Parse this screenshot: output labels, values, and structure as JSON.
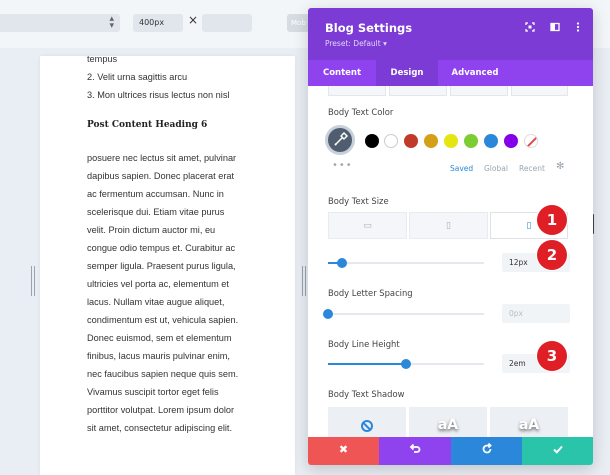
{
  "toolbar": {
    "width_value": "400px",
    "times_symbol": "×",
    "mobile_label": "Mob"
  },
  "preview": {
    "list_items": [
      "tempus",
      "2. Velit urna sagittis arcu",
      "3. Mon ultrices risus lectus non nisl"
    ],
    "heading": "Post Content Heading 6",
    "paragraph_lines": [
      "posuere nec lectus sit amet, pulvinar",
      "dapibus sapien. Donec placerat erat",
      "ac fermentum accumsan. Nunc in",
      "scelerisque dui. Etiam vitae purus",
      "velit. Proin dictum auctor mi, eu",
      "congue odio tempus et. Curabitur ac",
      "semper ligula. Praesent purus ligula,",
      "ultricies vel porta ac, elementum et",
      "lacus. Nullam vitae augue aliquet,",
      "condimentum est ut, vehicula sapien.",
      "Donec euismod, sem et elementum",
      "finibus, lacus mauris pulvinar enim,",
      "nec faucibus sapien neque quis sem.",
      "Vivamus suscipit tortor eget felis",
      "porttitor volutpat. Lorem ipsum dolor",
      "sit amet, consectetur adipiscing elit."
    ]
  },
  "panel": {
    "title": "Blog Settings",
    "preset": "Preset: Default ▾",
    "tabs": [
      "Content",
      "Design",
      "Advanced"
    ],
    "active_tab": "Design",
    "body_text_color_label": "Body Text Color",
    "swatches": [
      "#000000",
      "#ffffff",
      "#c0392b",
      "#d4a017",
      "#e5e510",
      "#7ccd34",
      "#2b87da",
      "#8300e9"
    ],
    "color_source_tabs": [
      "Saved",
      "Global",
      "Recent"
    ],
    "more_dots": "•••",
    "body_text_size_label": "Body Text Size",
    "text_size_value": "12px",
    "text_size_fraction": 0.09,
    "letter_spacing_label": "Body Letter Spacing",
    "letter_spacing_placeholder": "0px",
    "letter_spacing_fraction": 0.0,
    "line_height_label": "Body Line Height",
    "line_height_value": "2em",
    "line_height_fraction": 0.5,
    "text_shadow_label": "Body Text Shadow",
    "shadow_preview_text": "aA",
    "footer_colors": {
      "cancel": "#ef5555",
      "undo": "#8f43ee",
      "redo": "#2b87da",
      "save": "#29c4a9"
    },
    "accent": "#7b3bd4"
  },
  "annotations": [
    "1",
    "2",
    "3"
  ]
}
